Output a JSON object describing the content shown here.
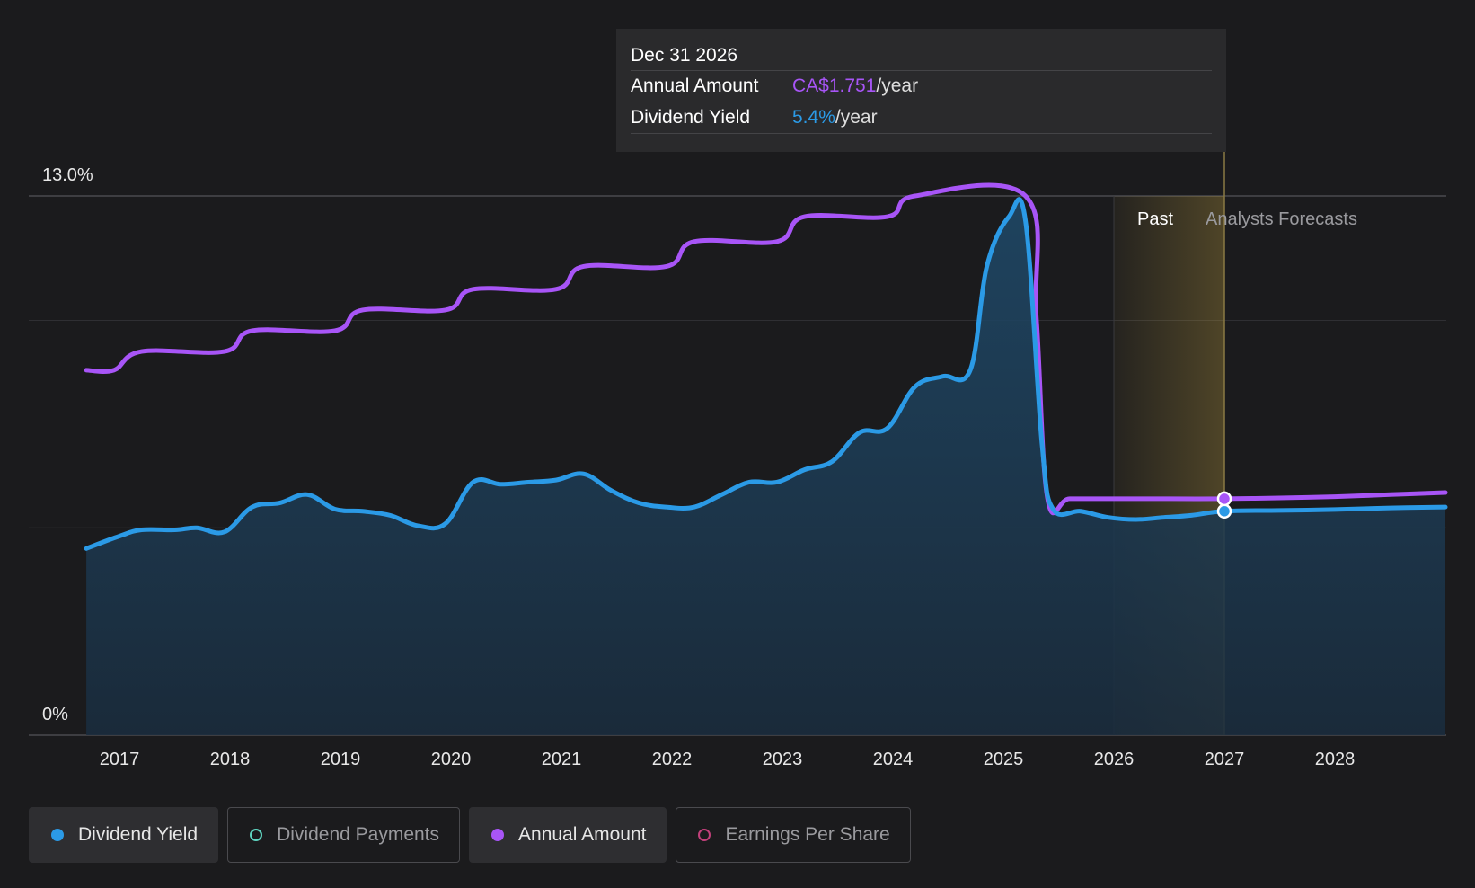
{
  "tooltip": {
    "date": "Dec 31 2026",
    "rows": [
      {
        "label": "Annual Amount",
        "value": "CA$1.751",
        "unit": "/year"
      },
      {
        "label": "Dividend Yield",
        "value": "5.4%",
        "unit": "/year"
      }
    ]
  },
  "regions": {
    "past": "Past",
    "forecast": "Analysts Forecasts"
  },
  "legend": [
    {
      "label": "Dividend Yield",
      "color": "#2b9ae6",
      "active": true,
      "filled": true
    },
    {
      "label": "Dividend Payments",
      "color": "#5fd4c0",
      "active": false,
      "filled": false
    },
    {
      "label": "Annual Amount",
      "color": "#a855f7",
      "active": true,
      "filled": true
    },
    {
      "label": "Earnings Per Share",
      "color": "#c2407a",
      "active": false,
      "filled": false
    }
  ],
  "colors": {
    "yield": "#2b9ae6",
    "amount": "#a855f7",
    "background": "#1b1b1d",
    "forecast_band": "#c8a640"
  },
  "chart_data": {
    "type": "line",
    "y_ticks": [
      "13.0%",
      "0%"
    ],
    "ylim": [
      0,
      13
    ],
    "xlim": [
      2016.5,
      2029
    ],
    "x_ticks": [
      "2017",
      "2018",
      "2019",
      "2020",
      "2021",
      "2022",
      "2023",
      "2024",
      "2025",
      "2026",
      "2027",
      "2028"
    ],
    "grid": true,
    "forecast_band": [
      2026,
      2027
    ],
    "tooltip_x": 2027,
    "series": [
      {
        "name": "Dividend Yield",
        "unit": "%",
        "fill": true,
        "points": [
          [
            2016.7,
            4.5
          ],
          [
            2017.0,
            4.8
          ],
          [
            2017.2,
            4.95
          ],
          [
            2017.5,
            4.95
          ],
          [
            2017.7,
            5.0
          ],
          [
            2017.95,
            4.9
          ],
          [
            2018.2,
            5.5
          ],
          [
            2018.45,
            5.6
          ],
          [
            2018.7,
            5.8
          ],
          [
            2018.95,
            5.45
          ],
          [
            2019.2,
            5.4
          ],
          [
            2019.45,
            5.3
          ],
          [
            2019.7,
            5.05
          ],
          [
            2019.95,
            5.1
          ],
          [
            2020.2,
            6.1
          ],
          [
            2020.45,
            6.05
          ],
          [
            2020.7,
            6.1
          ],
          [
            2020.95,
            6.15
          ],
          [
            2021.2,
            6.3
          ],
          [
            2021.45,
            5.9
          ],
          [
            2021.7,
            5.6
          ],
          [
            2021.95,
            5.5
          ],
          [
            2022.2,
            5.5
          ],
          [
            2022.45,
            5.8
          ],
          [
            2022.7,
            6.1
          ],
          [
            2022.95,
            6.1
          ],
          [
            2023.2,
            6.4
          ],
          [
            2023.45,
            6.6
          ],
          [
            2023.7,
            7.3
          ],
          [
            2023.95,
            7.4
          ],
          [
            2024.2,
            8.4
          ],
          [
            2024.45,
            8.65
          ],
          [
            2024.7,
            8.8
          ],
          [
            2024.85,
            11.3
          ],
          [
            2025.05,
            12.5
          ],
          [
            2025.2,
            12.4
          ],
          [
            2025.35,
            7.0
          ],
          [
            2025.45,
            5.45
          ],
          [
            2025.7,
            5.4
          ],
          [
            2025.95,
            5.25
          ],
          [
            2026.2,
            5.2
          ],
          [
            2026.45,
            5.25
          ],
          [
            2026.7,
            5.3
          ],
          [
            2027.0,
            5.4
          ],
          [
            2027.5,
            5.42
          ],
          [
            2028.0,
            5.44
          ],
          [
            2028.5,
            5.48
          ],
          [
            2029.0,
            5.5
          ]
        ]
      },
      {
        "name": "Annual Amount",
        "points": [
          [
            2016.7,
            8.8
          ],
          [
            2016.95,
            8.8
          ],
          [
            2017.2,
            9.25
          ],
          [
            2017.95,
            9.25
          ],
          [
            2018.2,
            9.75
          ],
          [
            2018.95,
            9.75
          ],
          [
            2019.2,
            10.25
          ],
          [
            2019.95,
            10.25
          ],
          [
            2020.2,
            10.75
          ],
          [
            2020.95,
            10.75
          ],
          [
            2021.2,
            11.3
          ],
          [
            2021.95,
            11.3
          ],
          [
            2022.2,
            11.9
          ],
          [
            2022.95,
            11.9
          ],
          [
            2023.2,
            12.5
          ],
          [
            2023.95,
            12.5
          ],
          [
            2024.2,
            13.0
          ],
          [
            2025.2,
            13.0
          ],
          [
            2025.3,
            10.0
          ],
          [
            2025.4,
            5.7
          ],
          [
            2025.6,
            5.7
          ],
          [
            2026.0,
            5.7
          ],
          [
            2026.5,
            5.7
          ],
          [
            2027.0,
            5.7
          ],
          [
            2027.5,
            5.72
          ],
          [
            2028.0,
            5.75
          ],
          [
            2028.5,
            5.8
          ],
          [
            2029.0,
            5.85
          ]
        ]
      }
    ]
  }
}
